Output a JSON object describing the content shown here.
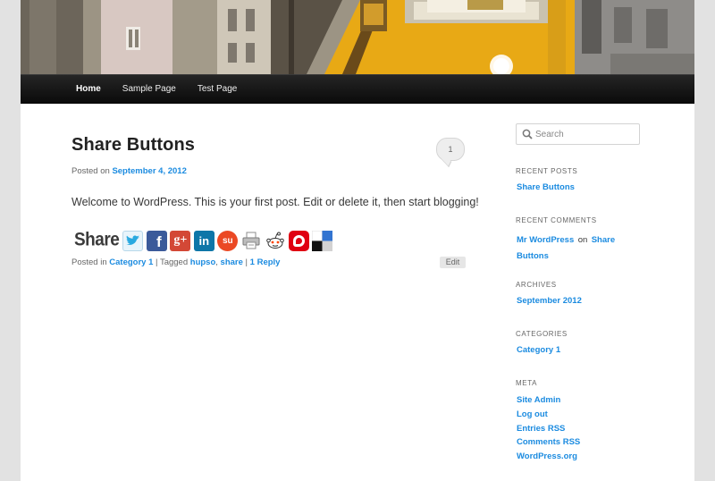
{
  "nav": {
    "items": [
      {
        "label": "Home",
        "current": true
      },
      {
        "label": "Sample Page",
        "current": false
      },
      {
        "label": "Test Page",
        "current": false
      }
    ]
  },
  "post": {
    "title": "Share Buttons",
    "comment_count": "1",
    "posted_on_prefix": "Posted on",
    "date": "September 4, 2012",
    "body": "Welcome to WordPress. This is your first post. Edit or delete it, then start blogging!",
    "share_label": "Share",
    "share_icons": [
      "twitter-icon",
      "facebook-icon",
      "google-plus-icon",
      "linkedin-icon",
      "stumbleupon-icon",
      "print-icon",
      "reddit-icon",
      "bebo-icon",
      "delicious-icon"
    ],
    "posted_in_prefix": "Posted in",
    "category": "Category 1",
    "tagged_prefix": "Tagged",
    "tag1": "hupso",
    "tag_sep": ",",
    "tag2": "share",
    "sep": "|",
    "reply": "1 Reply",
    "edit_label": "Edit"
  },
  "sidebar": {
    "search_placeholder": "Search",
    "recent_posts_title": "RECENT POSTS",
    "recent_posts": [
      "Share Buttons"
    ],
    "recent_comments_title": "RECENT COMMENTS",
    "recent_comment": {
      "author": "Mr WordPress",
      "on": "on",
      "post_line1": "Share",
      "post_line2": "Buttons"
    },
    "archives_title": "ARCHIVES",
    "archives": [
      "September 2012"
    ],
    "categories_title": "CATEGORIES",
    "categories": [
      "Category 1"
    ],
    "meta_title": "META",
    "meta_links": [
      "Site Admin",
      "Log out",
      "Entries RSS",
      "Comments RSS",
      "WordPress.org"
    ]
  },
  "colors": {
    "link": "#1b8be0",
    "nav_bg": "#111111",
    "tram_yellow": "#e8a915"
  }
}
